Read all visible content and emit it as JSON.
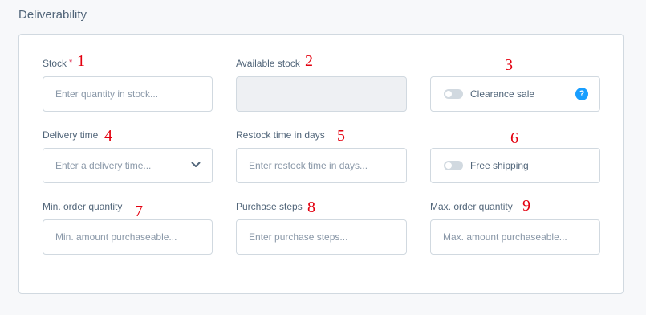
{
  "section": {
    "title": "Deliverability"
  },
  "fields": {
    "stock": {
      "label": "Stock",
      "required_mark": "*",
      "placeholder": "Enter quantity in stock...",
      "marker": "1"
    },
    "available_stock": {
      "label": "Available stock",
      "marker": "2"
    },
    "clearance_sale": {
      "label": "Clearance sale",
      "help": "?",
      "marker": "3"
    },
    "delivery_time": {
      "label": "Delivery time",
      "placeholder": "Enter a delivery time...",
      "marker": "4"
    },
    "restock_time": {
      "label": "Restock time in days",
      "placeholder": "Enter restock time in days...",
      "marker": "5"
    },
    "free_shipping": {
      "label": "Free shipping",
      "marker": "6"
    },
    "min_order": {
      "label": "Min. order quantity",
      "placeholder": "Min. amount purchaseable...",
      "marker": "7"
    },
    "purchase_steps": {
      "label": "Purchase steps",
      "placeholder": "Enter purchase steps...",
      "marker": "8"
    },
    "max_order": {
      "label": "Max. order quantity",
      "placeholder": "Max. amount purchaseable...",
      "marker": "9"
    }
  },
  "colors": {
    "accent": "#189eff",
    "required": "#de294c",
    "marker": "#e3000f",
    "border": "#d1d9e0"
  }
}
